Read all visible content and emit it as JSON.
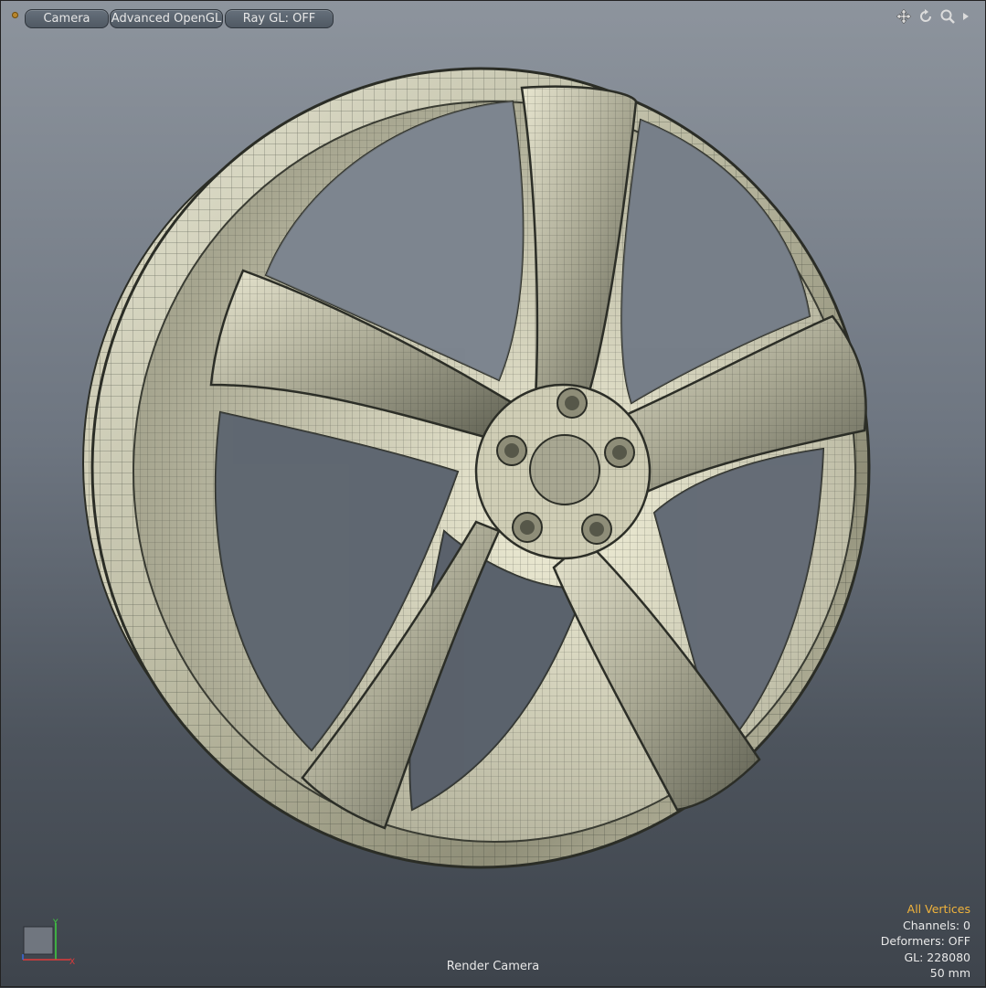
{
  "toolbar": {
    "camera_label": "Camera",
    "opengl_label": "Advanced OpenGL",
    "raygl_label": "Ray GL: OFF"
  },
  "toolicons": [
    "move-icon",
    "rotate-icon",
    "zoom-icon",
    "expand-arrow-icon"
  ],
  "viewport": {
    "camera_name": "Render Camera"
  },
  "axis": {
    "y_label": "Y",
    "x_label": "X"
  },
  "stats": {
    "selection_mode": "All Vertices",
    "channels": "Channels: 0",
    "deformers": "Deformers: OFF",
    "gl": "GL: 228080",
    "focal_length": "50 mm"
  },
  "colors": {
    "accent": "#f0b33c",
    "model_surface": "#d8d6bd",
    "wire": "#3a3d34"
  }
}
